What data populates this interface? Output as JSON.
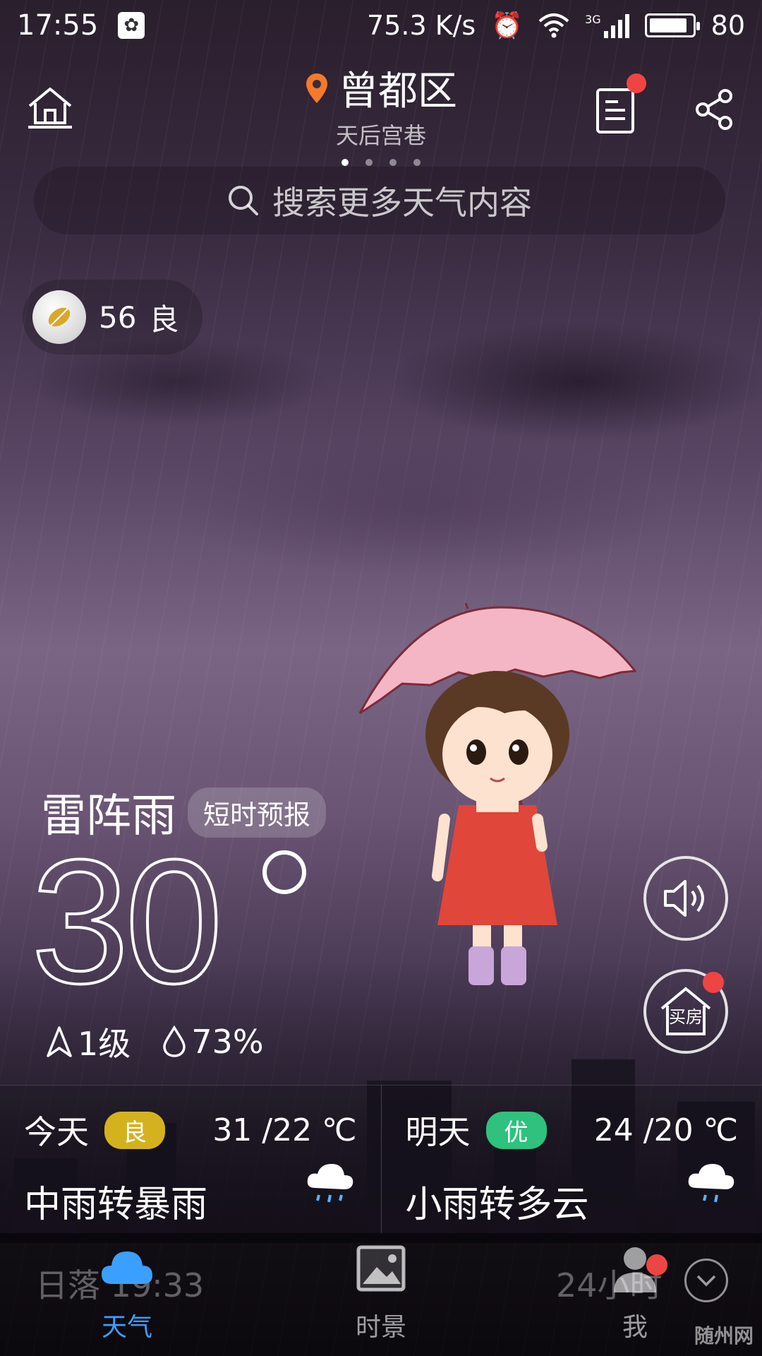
{
  "status_bar": {
    "time": "17:55",
    "speed": "75.3 K/s",
    "network": "3G",
    "battery": "80"
  },
  "header": {
    "location": "曾都区",
    "sublocation": "天后宫巷",
    "page_count": 4,
    "active_page": 0
  },
  "search": {
    "placeholder": "搜索更多天气内容"
  },
  "aqi": {
    "value": "56",
    "level": "良"
  },
  "current": {
    "condition": "雷阵雨",
    "chip": "短时预报",
    "temperature": "30",
    "wind": "1级",
    "humidity": "73%"
  },
  "forecast": [
    {
      "day": "今天",
      "aqi": "良",
      "aqi_color": "#d4b21e",
      "temp": "31 /22 ℃",
      "desc": "中雨转暴雨"
    },
    {
      "day": "明天",
      "aqi": "优",
      "aqi_color": "#2ec27e",
      "temp": "24 /20 ℃",
      "desc": "小雨转多云"
    }
  ],
  "bottom": {
    "sunset": "日落 19:33",
    "hours": "24小时",
    "tabs": [
      {
        "label": "天气",
        "icon": "cloud-icon"
      },
      {
        "label": "时景",
        "icon": "picture-icon"
      },
      {
        "label": "我",
        "icon": "person-icon"
      }
    ]
  },
  "house_button_label": "买房",
  "watermark": "随州网",
  "colors": {
    "accent": "#3aa0ff",
    "badge_red": "#ef4444",
    "location_pin": "#f37a2a"
  }
}
